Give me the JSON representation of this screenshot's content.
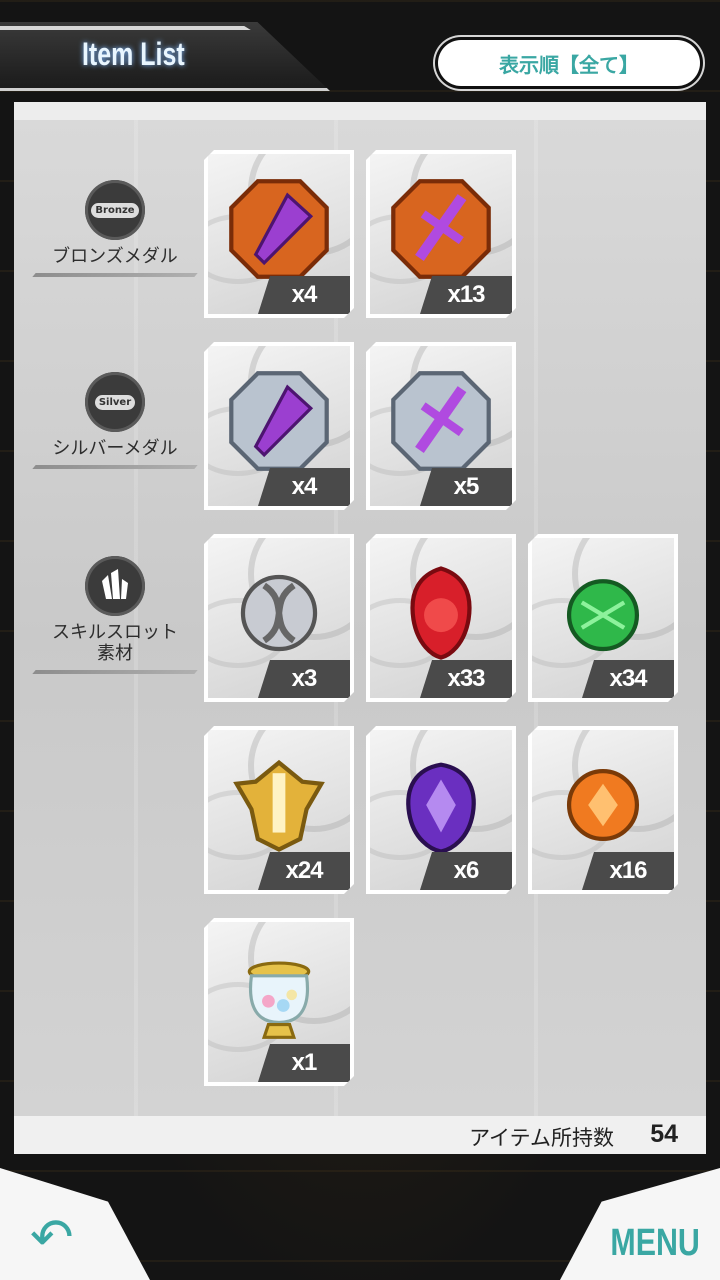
{
  "header": {
    "title": "Item List",
    "sort_label": "表示順【全て】"
  },
  "categories": [
    {
      "icon": "bronze-medal-icon",
      "badge": "Bronze",
      "label": "ブロンズメダル"
    },
    {
      "icon": "silver-medal-icon",
      "badge": "Silver",
      "label": "シルバーメダル"
    },
    {
      "icon": "crystal-icon",
      "label_line1": "スキルスロット",
      "label_line2": "素材"
    }
  ],
  "items": [
    {
      "icon": "bronze-drill-medal-icon",
      "count": "x4"
    },
    {
      "icon": "bronze-sword-medal-icon",
      "count": "x13"
    },
    {
      "icon": "silver-drill-medal-icon",
      "count": "x4"
    },
    {
      "icon": "silver-sword-medal-icon",
      "count": "x5"
    },
    {
      "icon": "silver-orb-icon",
      "count": "x3"
    },
    {
      "icon": "red-gem-icon",
      "count": "x33"
    },
    {
      "icon": "green-gem-icon",
      "count": "x34"
    },
    {
      "icon": "gold-crest-icon",
      "count": "x24"
    },
    {
      "icon": "purple-crest-icon",
      "count": "x6"
    },
    {
      "icon": "orange-gem-icon",
      "count": "x16"
    },
    {
      "icon": "candy-jar-icon",
      "count": "x1"
    }
  ],
  "footer": {
    "total_label": "アイテム所持数",
    "total_value": "54",
    "menu_label": "MENU"
  },
  "colors": {
    "accent": "#3aa7a3",
    "bronze": "#d8651f",
    "silver": "#b9c3cf"
  }
}
